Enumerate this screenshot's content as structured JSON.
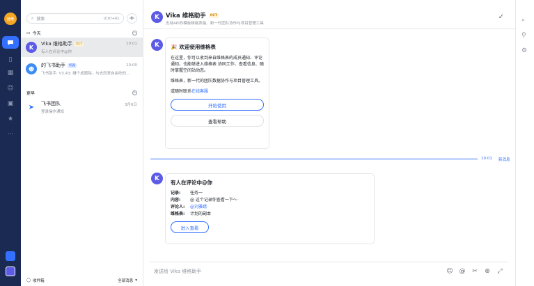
{
  "window": {
    "min": "—",
    "max": "❐",
    "close": "✕"
  },
  "rail": {
    "avatar_text": "分无",
    "icons": [
      "chat-icon",
      "doc-icon",
      "table-icon",
      "contacts-icon",
      "apps-icon",
      "star-icon",
      "more-icon"
    ],
    "more": "···"
  },
  "list": {
    "search_placeholder": "搜索",
    "search_shortcut": "(Ctrl+K)",
    "today": "今天",
    "earlier": "更早",
    "items": [
      {
        "name": "Vika 维格助手",
        "tag": "OCT",
        "preview": "有人在评论中@你",
        "time": "10:01"
      },
      {
        "name": "的飞书助手",
        "tag": "机器",
        "preview": "飞书助手: V3.43: 嫌个成题除，与去同来自由吃的…",
        "time": "10:00"
      },
      {
        "name": "飞书团队",
        "tag": "",
        "preview": "登录操作通知",
        "time": "3月6日"
      }
    ],
    "footer_left": "收件箱",
    "footer_right": "全部消息"
  },
  "chat": {
    "title": "Vika 维格助手",
    "title_tag": "OCT",
    "subtitle": "支持API的模板维格表格、新一代团队协作与项目管理工具",
    "welcome": {
      "title": "欢迎使用维格表",
      "p1": "在这里，你可以收到来自维格表的成员通知、评论通知，也能够进入维格表 协同工作、查看信息、随时掌握空间站动态。",
      "p2": "维格表，新一代的团队数据协作与项目管理工具。",
      "p3_prefix": "或随时联系",
      "p3_link": "在线客服",
      "btn_start": "开始使用",
      "btn_help": "查看帮助"
    },
    "divider_time": "10:01",
    "divider_label": "新消息",
    "mention": {
      "title": "有人在评论中@你",
      "rows": [
        {
          "k": "记录:",
          "v": "任务一"
        },
        {
          "k": "内容:",
          "v": "@          这个记录你查看一下～"
        },
        {
          "k": "评论人:",
          "v": "@刘雅婧"
        },
        {
          "k": "维格表:",
          "v": "计划的副本"
        }
      ],
      "btn": "进入查看"
    },
    "input_placeholder": "发送给 Vika 维格助手"
  }
}
